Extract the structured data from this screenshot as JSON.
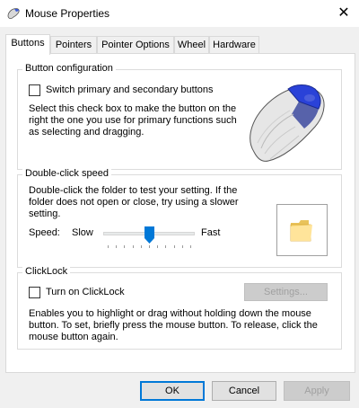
{
  "window": {
    "title": "Mouse Properties",
    "close_glyph": "✕"
  },
  "tabs": [
    {
      "label": "Buttons",
      "active": true
    },
    {
      "label": "Pointers",
      "active": false
    },
    {
      "label": "Pointer Options",
      "active": false
    },
    {
      "label": "Wheel",
      "active": false
    },
    {
      "label": "Hardware",
      "active": false
    }
  ],
  "button_configuration": {
    "legend": "Button configuration",
    "checkbox_label": "Switch primary and secondary buttons",
    "checked": false,
    "description_lines": [
      "Select this check box to make the button on the",
      "right the one you use for primary functions such",
      "as selecting and dragging."
    ]
  },
  "double_click": {
    "legend": "Double-click speed",
    "description_lines": [
      "Double-click the folder to test your setting.  If the",
      "folder does not open or close, try using a slower",
      "setting."
    ],
    "speed_label": "Speed:",
    "slow_label": "Slow",
    "fast_label": "Fast",
    "slider_value_fraction": 0.5,
    "tick_count": 11,
    "folder_icon": "folder-icon"
  },
  "clicklock": {
    "legend": "ClickLock",
    "checkbox_label": "Turn on ClickLock",
    "checked": false,
    "settings_label": "Settings...",
    "description_lines": [
      "Enables you to highlight or drag without holding down the mouse",
      "button. To set, briefly press the mouse button. To release, click the",
      "mouse button again."
    ]
  },
  "footer": {
    "ok_label": "OK",
    "cancel_label": "Cancel",
    "apply_label": "Apply"
  },
  "colors": {
    "accent": "#0078d7",
    "mouse_highlight": "#1e3cd6"
  }
}
